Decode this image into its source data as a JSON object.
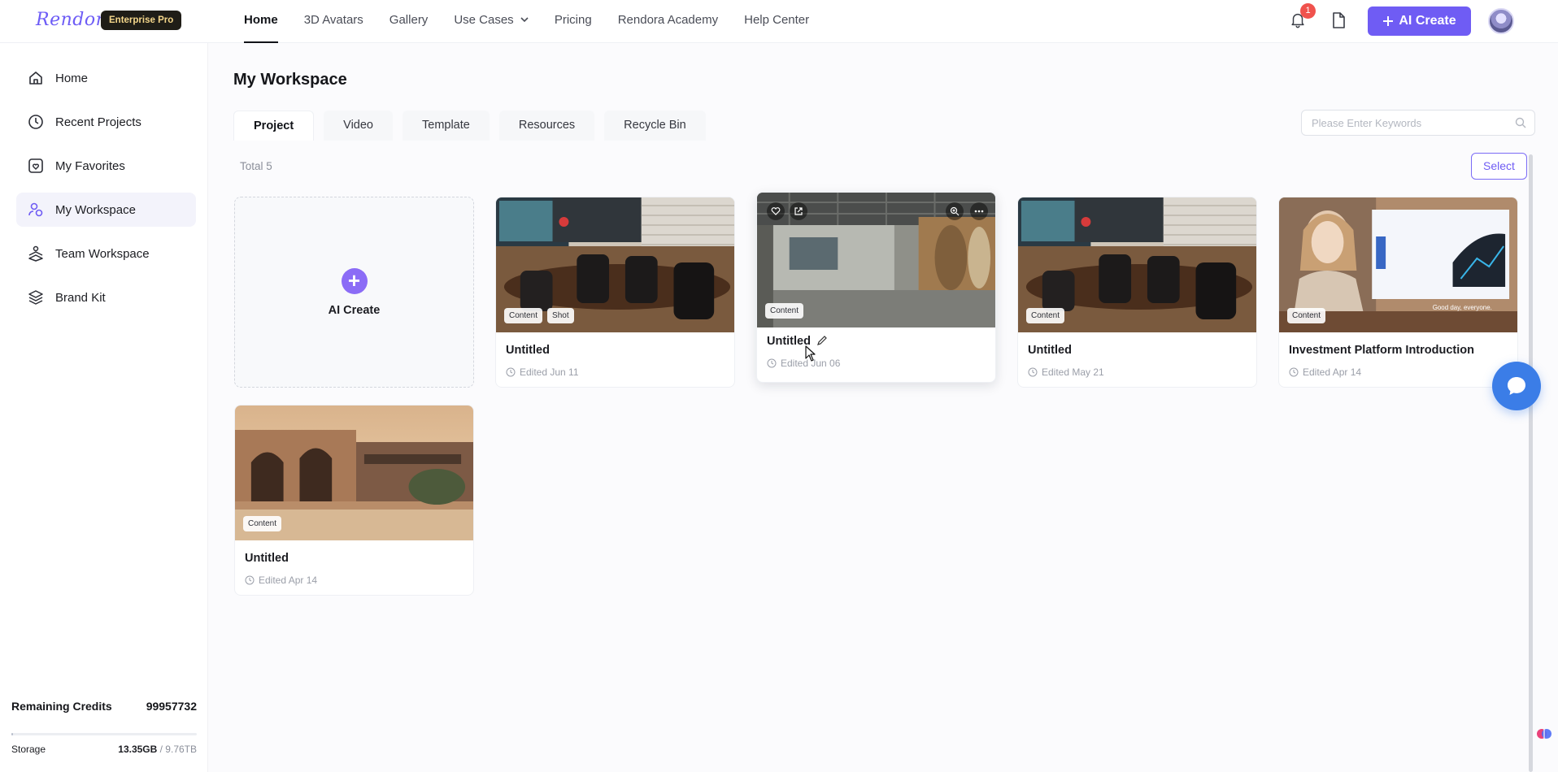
{
  "brand": {
    "logo_text": "Rendora",
    "plan_badge": "Enterprise Pro"
  },
  "nav": [
    {
      "label": "Home",
      "active": true
    },
    {
      "label": "3D Avatars"
    },
    {
      "label": "Gallery"
    },
    {
      "label": "Use Cases",
      "has_dropdown": true
    },
    {
      "label": "Pricing"
    },
    {
      "label": "Rendora Academy"
    },
    {
      "label": "Help Center"
    }
  ],
  "header": {
    "notification_count": "1",
    "ai_create_label": "AI Create"
  },
  "sidebar": {
    "items": [
      {
        "label": "Home",
        "icon": "home-icon"
      },
      {
        "label": "Recent Projects",
        "icon": "clock-icon"
      },
      {
        "label": "My Favorites",
        "icon": "favorites-icon"
      },
      {
        "label": "My Workspace",
        "icon": "workspace-icon",
        "active": true
      },
      {
        "label": "Team Workspace",
        "icon": "team-icon"
      },
      {
        "label": "Brand Kit",
        "icon": "layers-icon"
      }
    ],
    "credits_label": "Remaining Credits",
    "credits_value": "99957732",
    "storage_label": "Storage",
    "storage_used": "13.35GB",
    "storage_total": "/ 9.76TB",
    "storage_fraction": 0.0014
  },
  "main": {
    "title": "My Workspace",
    "tabs": [
      {
        "label": "Project",
        "active": true
      },
      {
        "label": "Video"
      },
      {
        "label": "Template"
      },
      {
        "label": "Resources"
      },
      {
        "label": "Recycle Bin"
      }
    ],
    "search_placeholder": "Please Enter Keywords",
    "total_text": "Total 5",
    "select_label": "Select",
    "create_card_label": "AI Create",
    "cards": [
      {
        "title": "Untitled",
        "date": "Edited Jun 11",
        "tags": [
          "Content",
          "Shot"
        ],
        "scene": "meeting-room"
      },
      {
        "title": "Untitled",
        "date": "Edited Jun 06",
        "tags": [
          "Content"
        ],
        "scene": "office-lobby",
        "hovered": true
      },
      {
        "title": "Untitled",
        "date": "Edited May 21",
        "tags": [
          "Content"
        ],
        "scene": "meeting-room"
      },
      {
        "title": "Investment Platform Introduction",
        "date": "Edited Apr 14",
        "tags": [
          "Content"
        ],
        "scene": "presenter",
        "slide_text": "Good day, everyone."
      },
      {
        "title": "Untitled",
        "date": "Edited Apr 14",
        "tags": [
          "Content"
        ],
        "scene": "desert-villa"
      }
    ]
  },
  "colors": {
    "accent": "#6f5cf4",
    "badge_red": "#f0524d",
    "chat_blue": "#3b7de7"
  }
}
